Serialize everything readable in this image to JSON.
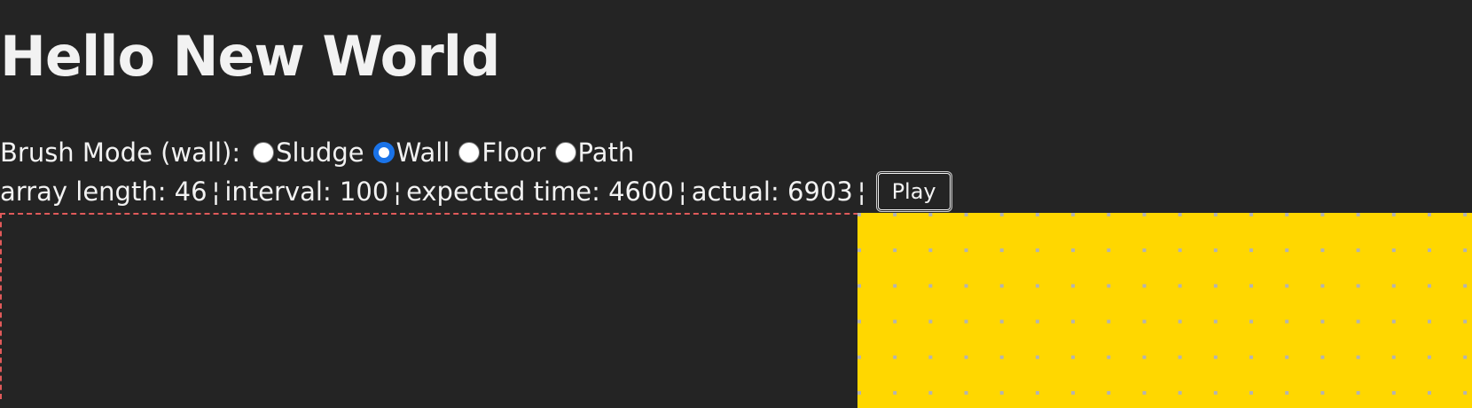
{
  "page": {
    "title": "Hello New World"
  },
  "brush": {
    "label": "Brush Mode (wall):",
    "options": [
      "Sludge",
      "Wall",
      "Floor",
      "Path"
    ],
    "selected": "Wall"
  },
  "stats": {
    "array_length_text": "array length: 46",
    "interval_text": "interval: 100",
    "expected_time_text": "expected time: 4600",
    "actual_text": "actual: 6903",
    "separator": "¦"
  },
  "controls": {
    "play_label": "Play"
  },
  "grid": {
    "cell_color": "#ffd700",
    "line_color": "#b3b3b3"
  },
  "colors": {
    "background": "#242424",
    "canvas_border": "#e05a5a",
    "radio_accent": "#1a73e8"
  }
}
